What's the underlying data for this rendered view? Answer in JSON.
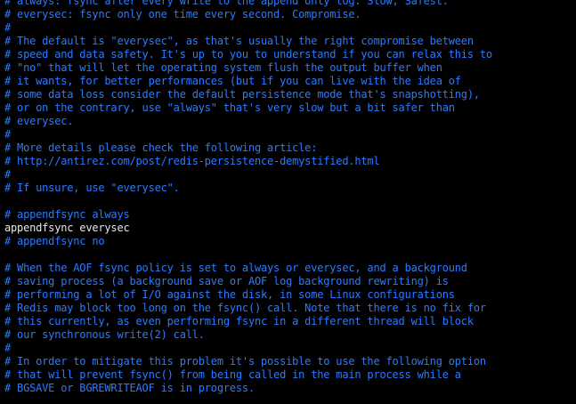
{
  "colors": {
    "background": "#000000",
    "comment": "#2b7bff",
    "code": "#e8e8e8"
  },
  "lines": [
    {
      "type": "comment",
      "text": "# always: fsync after every write to the append only log. Slow, Safest."
    },
    {
      "type": "comment",
      "text": "# everysec: fsync only one time every second. Compromise."
    },
    {
      "type": "comment",
      "text": "#"
    },
    {
      "type": "comment",
      "text": "# The default is \"everysec\", as that's usually the right compromise between"
    },
    {
      "type": "comment",
      "text": "# speed and data safety. It's up to you to understand if you can relax this to"
    },
    {
      "type": "comment",
      "text": "# \"no\" that will let the operating system flush the output buffer when"
    },
    {
      "type": "comment",
      "text": "# it wants, for better performances (but if you can live with the idea of"
    },
    {
      "type": "comment",
      "text": "# some data loss consider the default persistence mode that's snapshotting),"
    },
    {
      "type": "comment",
      "text": "# or on the contrary, use \"always\" that's very slow but a bit safer than"
    },
    {
      "type": "comment",
      "text": "# everysec."
    },
    {
      "type": "comment",
      "text": "#"
    },
    {
      "type": "comment",
      "text": "# More details please check the following article:"
    },
    {
      "type": "comment",
      "text": "# http://antirez.com/post/redis-persistence-demystified.html"
    },
    {
      "type": "comment",
      "text": "#"
    },
    {
      "type": "comment",
      "text": "# If unsure, use \"everysec\"."
    },
    {
      "type": "comment",
      "text": ""
    },
    {
      "type": "comment",
      "text": "# appendfsync always"
    },
    {
      "type": "code",
      "text": "appendfsync everysec"
    },
    {
      "type": "comment",
      "text": "# appendfsync no"
    },
    {
      "type": "comment",
      "text": ""
    },
    {
      "type": "comment",
      "text": "# When the AOF fsync policy is set to always or everysec, and a background"
    },
    {
      "type": "comment",
      "text": "# saving process (a background save or AOF log background rewriting) is"
    },
    {
      "type": "comment",
      "text": "# performing a lot of I/O against the disk, in some Linux configurations"
    },
    {
      "type": "comment",
      "text": "# Redis may block too long on the fsync() call. Note that there is no fix for"
    },
    {
      "type": "comment",
      "text": "# this currently, as even performing fsync in a different thread will block"
    },
    {
      "type": "comment",
      "text": "# our synchronous write(2) call."
    },
    {
      "type": "comment",
      "text": "#"
    },
    {
      "type": "comment",
      "text": "# In order to mitigate this problem it's possible to use the following option"
    },
    {
      "type": "comment",
      "text": "# that will prevent fsync() from being called in the main process while a"
    },
    {
      "type": "comment",
      "text": "# BGSAVE or BGREWRITEAOF is in progress."
    }
  ]
}
